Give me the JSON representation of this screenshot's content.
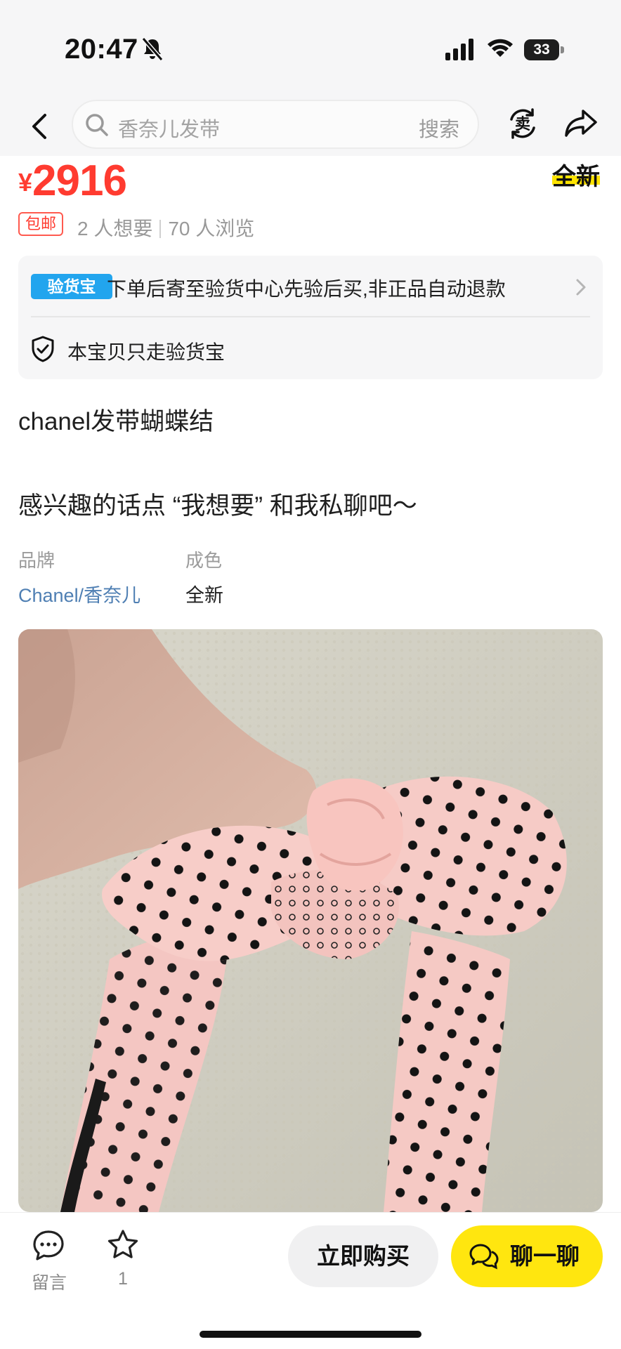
{
  "status_bar": {
    "time": "20:47",
    "battery": "33"
  },
  "nav": {
    "search_placeholder": "香奈儿发带",
    "search_button": "搜索",
    "sell_icon_char": "卖"
  },
  "listing": {
    "currency": "¥",
    "price": "2916",
    "condition_tag": "全新",
    "free_shipping": "包邮",
    "wants": "2 人想要",
    "views": "70 人浏览",
    "title": "chanel发带蝴蝶结",
    "description": "感兴趣的话点 “我想要” 和我私聊吧～"
  },
  "verification": {
    "logo_text": "验货宝",
    "message": "下单后寄至验货中心先验后买,非正品自动退款",
    "note": "本宝贝只走验货宝"
  },
  "attributes": [
    {
      "label": "品牌",
      "value": "Chanel/香奈儿"
    },
    {
      "label": "成色",
      "value": "全新"
    }
  ],
  "bottom_bar": {
    "comment_label": "留言",
    "favorite_count": "1",
    "buy_label": "立即购买",
    "chat_label": "聊一聊"
  },
  "colors": {
    "price": "#ff3b30",
    "accent_yellow": "#ffe60f",
    "verify_blue": "#22a5ee",
    "brand_link": "#4f7fb3"
  }
}
